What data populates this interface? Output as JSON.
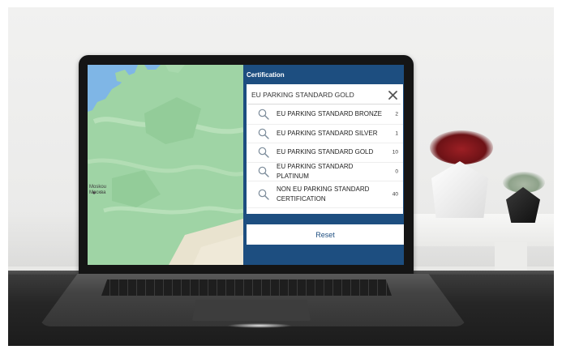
{
  "map": {
    "labels": [
      "Moskou",
      "Москва"
    ]
  },
  "panel": {
    "title": "Certification",
    "search_value": "EU PARKING STANDARD GOLD",
    "clear_icon": "close-icon",
    "options": [
      {
        "label": "EU PARKING STANDARD BRONZE",
        "count": "2"
      },
      {
        "label": "EU PARKING STANDARD SILVER",
        "count": "1"
      },
      {
        "label": "EU PARKING STANDARD GOLD",
        "count": "10"
      },
      {
        "label": "EU PARKING STANDARD PLATINUM",
        "count": "0"
      },
      {
        "label": "NON EU PARKING STANDARD CERTIFICATION",
        "count": "40"
      }
    ],
    "reset_label": "Reset"
  },
  "colors": {
    "panel_bg": "#1d4e80",
    "map_land": "#9fd4a5",
    "map_water": "#7fb6e6"
  }
}
